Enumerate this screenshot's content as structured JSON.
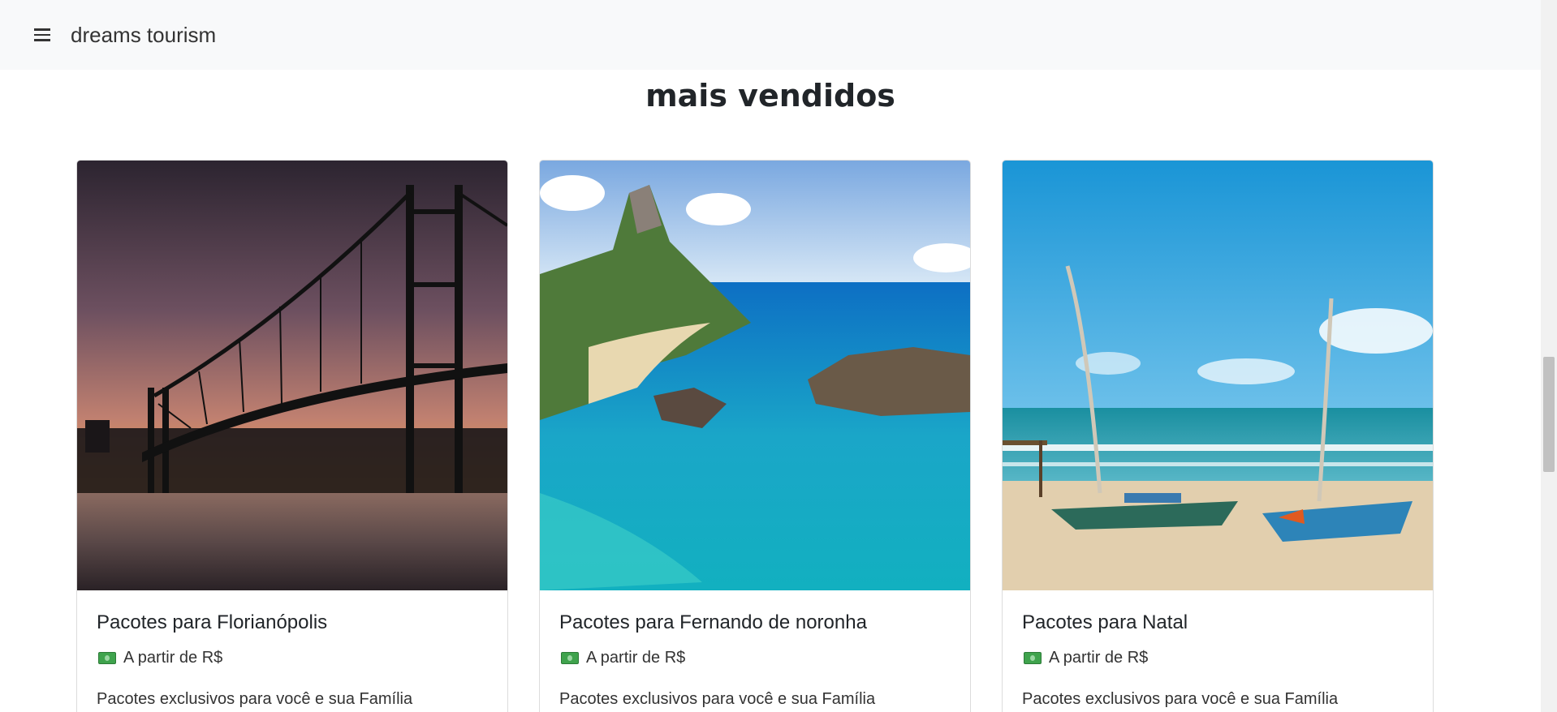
{
  "navbar": {
    "menu_icon": "hamburger-menu-icon",
    "brand": "dreams tourism"
  },
  "section": {
    "title": "mais vendidos"
  },
  "cards": [
    {
      "title": "Pacotes para Florianópolis",
      "price_icon": "money-banknote-icon",
      "price_label": "A partir de R$",
      "description": "Pacotes exclusivos para você e sua Família"
    },
    {
      "title": "Pacotes para Fernando de noronha",
      "price_icon": "money-banknote-icon",
      "price_label": "A partir de R$",
      "description": "Pacotes exclusivos para você e sua Família"
    },
    {
      "title": "Pacotes para Natal",
      "price_icon": "money-banknote-icon",
      "price_label": "A partir de R$",
      "description": "Pacotes exclusivos para você e sua Família"
    }
  ],
  "colors": {
    "navbar_bg": "#f8f9fa",
    "text": "#212529",
    "card_border": "#dcdcdc"
  }
}
